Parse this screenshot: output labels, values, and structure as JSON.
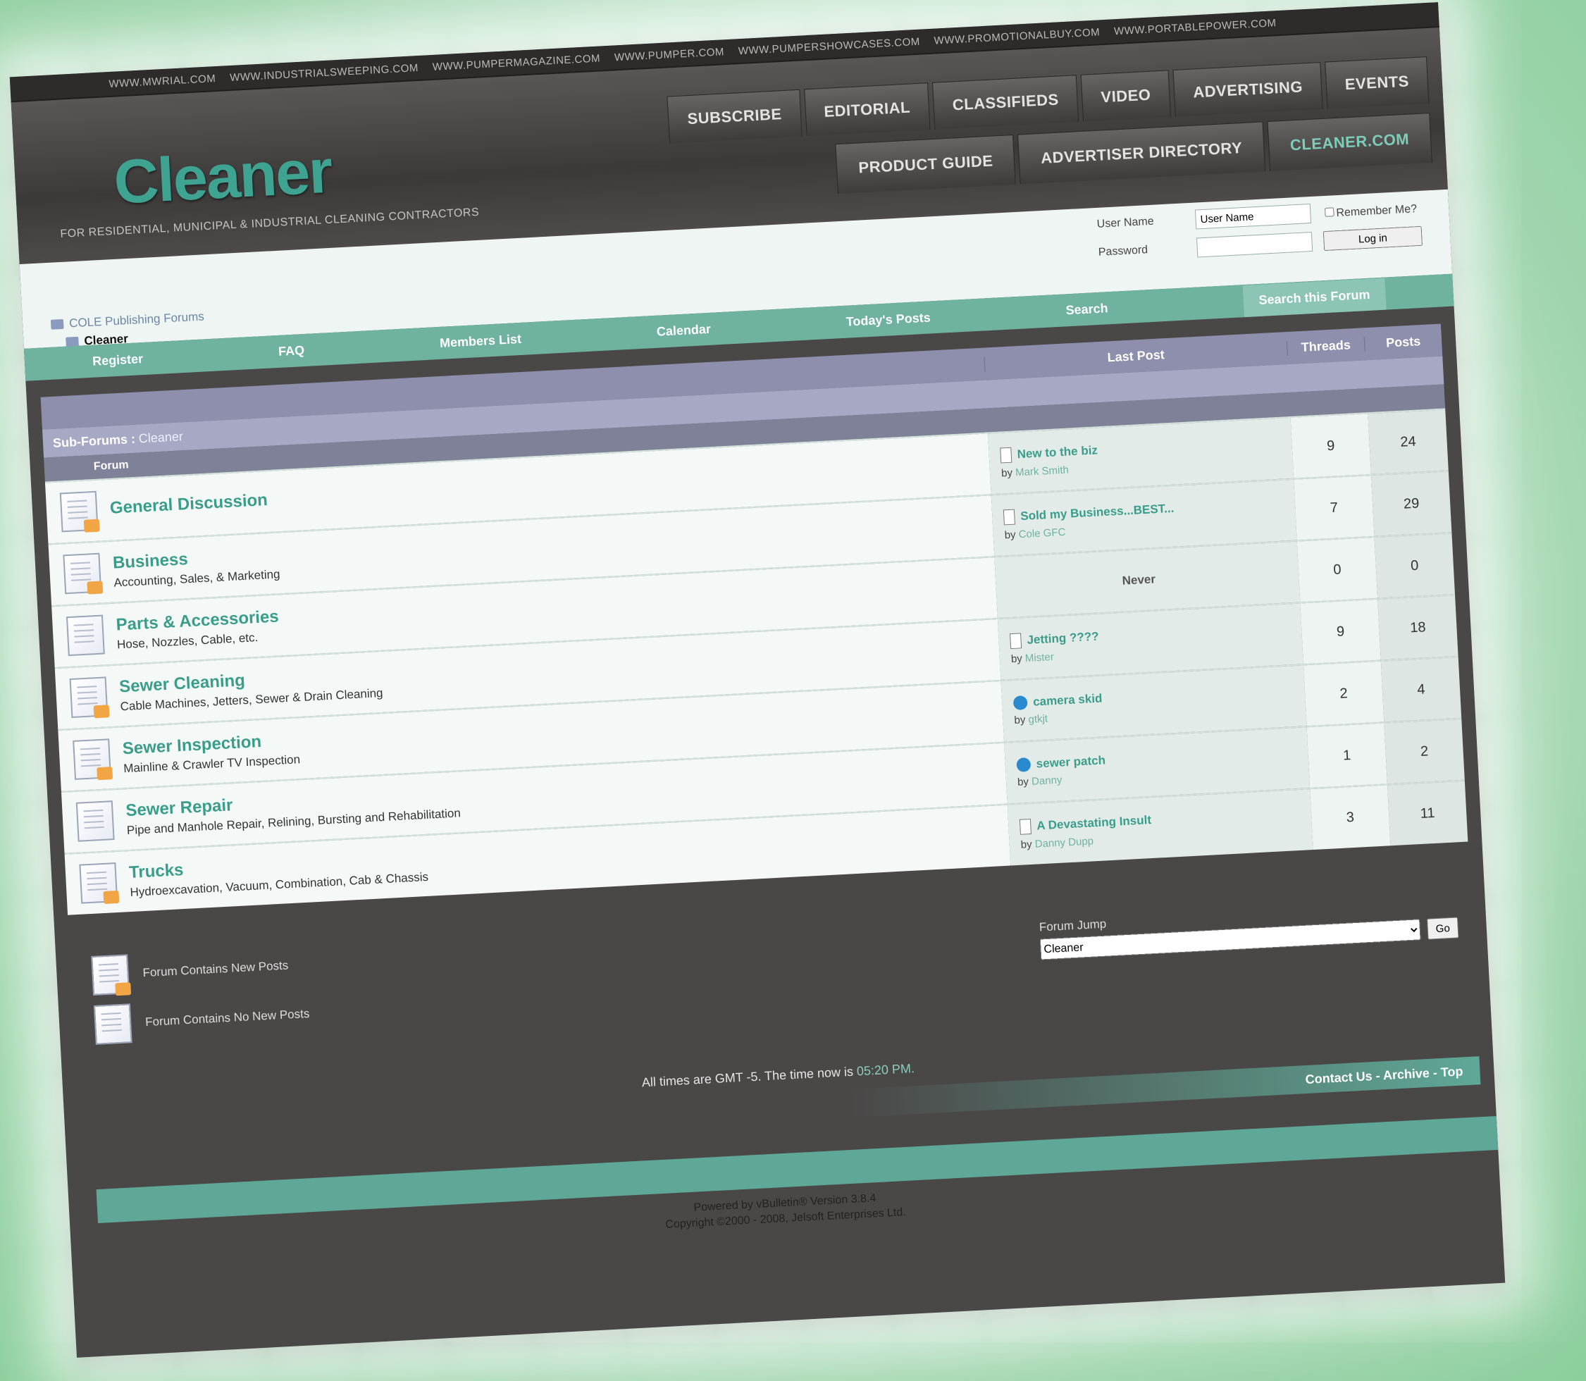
{
  "site_links": [
    "WWW.MWRIAL.COM",
    "WWW.INDUSTRIALSWEEPING.COM",
    "WWW.PUMPERMAGAZINE.COM",
    "WWW.PUMPER.COM",
    "WWW.PUMPERSHOWCASES.COM",
    "WWW.PROMOTIONALBUY.COM",
    "WWW.PORTABLEPOWER.COM"
  ],
  "header": {
    "logo": "Cleaner",
    "tagline": "FOR RESIDENTIAL, MUNICIPAL & INDUSTRIAL CLEANING CONTRACTORS",
    "tabs_top": [
      "SUBSCRIBE",
      "EDITORIAL",
      "CLASSIFIEDS",
      "VIDEO",
      "ADVERTISING",
      "EVENTS"
    ],
    "tabs_bottom": [
      "PRODUCT GUIDE",
      "ADVERTISER DIRECTORY",
      "CLEANER.COM"
    ]
  },
  "login": {
    "username_label": "User Name",
    "username_value": "User Name",
    "remember_label": "Remember Me?",
    "password_label": "Password",
    "login_button": "Log in"
  },
  "breadcrumb": {
    "root": "COLE Publishing Forums",
    "current": "Cleaner"
  },
  "nav": {
    "items": [
      "Register",
      "FAQ",
      "Members List",
      "Calendar",
      "Today's Posts",
      "Search"
    ],
    "search_forum": "Search this Forum"
  },
  "table": {
    "headers": {
      "last_post": "Last Post",
      "threads": "Threads",
      "posts": "Posts"
    },
    "subforums_label": "Sub-Forums",
    "subforums_current": "Cleaner",
    "forum_col": "Forum",
    "rows": [
      {
        "name": "General Discussion",
        "desc": "",
        "last_title": "New to the biz",
        "last_by": "Mark Smith",
        "threads": "9",
        "posts": "24",
        "icon": "new",
        "post_icon": "doc"
      },
      {
        "name": "Business",
        "desc": "Accounting, Sales, & Marketing",
        "last_title": "Sold my Business...BEST...",
        "last_by": "Cole GFC",
        "threads": "7",
        "posts": "29",
        "icon": "new",
        "post_icon": "doc"
      },
      {
        "name": "Parts & Accessories",
        "desc": "Hose, Nozzles, Cable, etc.",
        "last_title": "",
        "last_by": "",
        "never": "Never",
        "threads": "0",
        "posts": "0",
        "icon": "plain",
        "post_icon": ""
      },
      {
        "name": "Sewer Cleaning",
        "desc": "Cable Machines, Jetters, Sewer & Drain Cleaning",
        "last_title": "Jetting ????",
        "last_by": "Mister",
        "threads": "9",
        "posts": "18",
        "icon": "new",
        "post_icon": "doc"
      },
      {
        "name": "Sewer Inspection",
        "desc": "Mainline & Crawler TV Inspection",
        "last_title": "camera skid",
        "last_by": "gtkjt",
        "threads": "2",
        "posts": "4",
        "icon": "new",
        "post_icon": "blue"
      },
      {
        "name": "Sewer Repair",
        "desc": "Pipe and Manhole Repair, Relining, Bursting and Rehabilitation",
        "last_title": "sewer patch",
        "last_by": "Danny",
        "threads": "1",
        "posts": "2",
        "icon": "plain",
        "post_icon": "blue"
      },
      {
        "name": "Trucks",
        "desc": "Hydroexcavation, Vacuum, Combination, Cab & Chassis",
        "last_title": "A Devastating Insult",
        "last_by": "Danny Dupp",
        "threads": "3",
        "posts": "11",
        "icon": "new",
        "post_icon": "doc"
      }
    ]
  },
  "legend": {
    "new_posts": "Forum Contains New Posts",
    "no_new_posts": "Forum Contains No New Posts"
  },
  "forum_jump": {
    "label": "Forum Jump",
    "selected": "Cleaner",
    "go": "Go"
  },
  "times": {
    "text": "All times are GMT -5. The time now is",
    "now": "05:20 PM."
  },
  "footer_links": "Contact Us - Archive - Top",
  "powered": {
    "line1": "Powered by vBulletin® Version 3.8.4",
    "line2": "Copyright ©2000 - 2008, Jelsoft Enterprises Ltd."
  },
  "colors": {
    "accent": "#3fa391",
    "nav": "#6fb2a0",
    "table_head": "#8d8fad",
    "background": "#4a4747"
  }
}
